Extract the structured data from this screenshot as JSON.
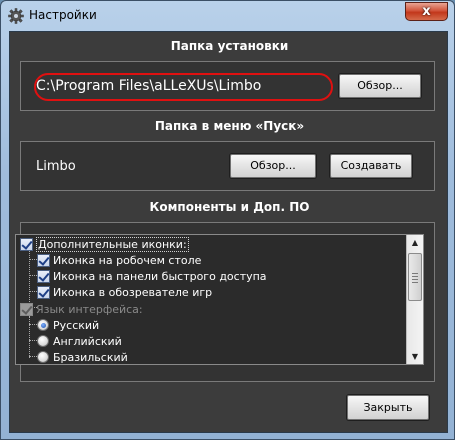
{
  "window": {
    "title": "Настройки",
    "close_glyph": "x"
  },
  "install": {
    "section_title": "Папка установки",
    "path": "C:\\Program Files\\aLLeXUs\\Limbo",
    "browse_label": "Обзор..."
  },
  "start_menu": {
    "section_title": "Папка в меню «Пуск»",
    "folder": "Limbo",
    "browse_label": "Обзор...",
    "create_label": "Создавать"
  },
  "components": {
    "section_title": "Компоненты и Доп. ПО",
    "items": [
      {
        "label": "Дополнительные иконки:",
        "type": "checkbox",
        "checked": true,
        "level": 0
      },
      {
        "label": "Иконка на робочем столе",
        "type": "checkbox",
        "checked": true,
        "level": 1
      },
      {
        "label": "Иконка на панели быстрого доступа",
        "type": "checkbox",
        "checked": true,
        "level": 1
      },
      {
        "label": "Иконка в обозревателе игр",
        "type": "checkbox",
        "checked": true,
        "level": 1
      },
      {
        "label": "Язык интерфейса:",
        "type": "checkbox",
        "checked": true,
        "disabled": true,
        "level": 0
      },
      {
        "label": "Русский",
        "type": "radio",
        "checked": true,
        "level": 1
      },
      {
        "label": "Английский",
        "type": "radio",
        "checked": false,
        "level": 1
      },
      {
        "label": "Бразильский",
        "type": "radio",
        "checked": false,
        "level": 1
      }
    ]
  },
  "footer": {
    "close_label": "Закрыть"
  },
  "icons": {
    "title": "gear-icon",
    "scroll_up": "scroll-up-arrow-icon",
    "scroll_down": "scroll-down-arrow-icon"
  },
  "colors": {
    "client_bg": "#3c3c3c",
    "highlight_ellipse": "#e01010"
  }
}
